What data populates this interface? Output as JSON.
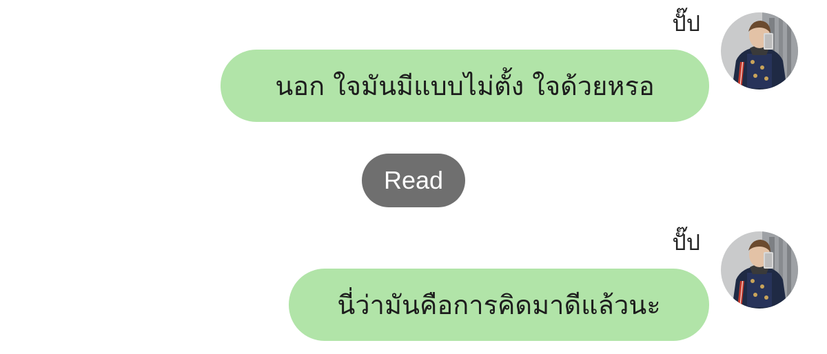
{
  "messages": [
    {
      "sender": "ปั๊ป",
      "text": "นอก ใจมันมีแบบไม่ตั้ง ใจด้วยหรอ",
      "avatar_icon": "profile-photo",
      "bubble_color": "#b1e4a8"
    },
    {
      "sender": "ปั๊ป",
      "text": "นี่ว่ามันคือการคิดมาดีแล้วนะ",
      "avatar_icon": "profile-photo",
      "bubble_color": "#b1e4a8"
    }
  ],
  "read_status": {
    "label": "Read",
    "color": "#6f6f6f"
  }
}
